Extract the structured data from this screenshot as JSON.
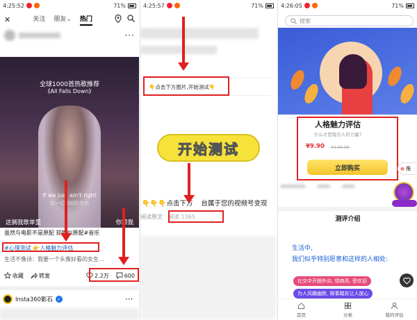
{
  "panel1": {
    "status": {
      "time": "4:25:52",
      "battery": "71%"
    },
    "nav": {
      "tab_follow": "关注",
      "tab_friends": "朋友",
      "tab_hot": "热门"
    },
    "video": {
      "title": "全球1000首热歌推荐",
      "subtitle": "《All Falls Down》",
      "lyric_en": "If we just ain't right",
      "lyric_cn": "若一切都相形失色",
      "subtitle_left": "这搁我歌单里",
      "subtitle_right": "你跟我"
    },
    "caption": "虽然与电影不是原配 却胜似原配#音乐",
    "tag_text": "#心理测试 👉人格魅力评估",
    "line2": "生活不像诗：我要一个头像好看的女生…",
    "actions": {
      "favorite": "收藏",
      "share": "转发",
      "likes": "2.2万",
      "comments": "600"
    },
    "account": "Insta360影石"
  },
  "panel2": {
    "status": {
      "time": "4:25:57",
      "battery": "71%"
    },
    "banner": "👇点击下方图片,开始测试👇",
    "start_button": "开始测试",
    "text_left": "👇👇👇点击下方",
    "text_right": "台属于您的视频号变现",
    "read_original": "阅读原文",
    "reads": "阅读 1365"
  },
  "panel3": {
    "status": {
      "time": "4:26:05",
      "battery": "71%"
    },
    "search_placeholder": "搜索",
    "product_title": "人格魅力评估",
    "product_sub": "什么才是吸引人的力量?",
    "price": "¥9.90",
    "original_price": "¥149.00",
    "buy_button": "立即购买",
    "side_badge": "推",
    "section_title": "测评介绍",
    "slogan_line1": "生活中,",
    "slogan_line2": "我们似乎特别愿意和这样的人相处:",
    "pill1": "社交中开朗外向, 情商高, 受欢迎",
    "pill2": "为人风趣幽默, 做事踏实让人放心",
    "tabbar": {
      "home": "首页",
      "category": "分类",
      "mine": "我的评估"
    }
  },
  "colors": {
    "annotation_red": "#e02020",
    "accent_blue": "#1a5fd8",
    "button_yellow": "#f7e23a"
  }
}
